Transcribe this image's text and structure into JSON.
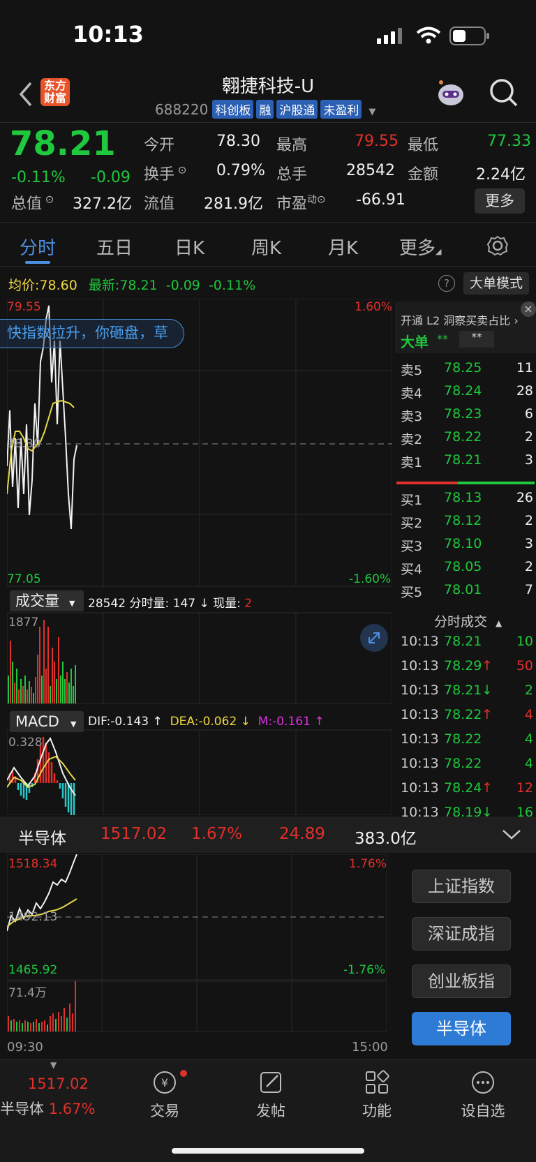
{
  "status": {
    "time": "10:13"
  },
  "header": {
    "title": "翱捷科技-U",
    "code": "688220",
    "tags": [
      "科创板",
      "融",
      "沪股通",
      "未盈利"
    ],
    "logo_line1": "东方",
    "logo_line2": "财富"
  },
  "quote": {
    "price": "78.21",
    "pct": "-0.11%",
    "chg": "-0.09",
    "open_label": "今开",
    "open": "78.30",
    "high_label": "最高",
    "high": "79.55",
    "low_label": "最低",
    "low": "77.33",
    "turnover_label": "换手",
    "turnover": "0.79%",
    "volume_label": "总手",
    "volume": "28542",
    "amount_label": "金额",
    "amount": "2.24亿",
    "mktcap_label": "总值",
    "mktcap": "327.2亿",
    "float_label": "流值",
    "float": "281.9亿",
    "pe_label": "市盈",
    "pe_sup": "动",
    "pe": "-66.91",
    "more": "更多"
  },
  "tabs": [
    "分时",
    "五日",
    "日K",
    "周K",
    "月K",
    "更多"
  ],
  "avg_bar": {
    "avg_label": "均价:",
    "avg": "78.60",
    "latest_label": "最新:",
    "latest": "78.21",
    "chg": "-0.09",
    "pct": "-0.11%",
    "mode_button": "大单模式"
  },
  "chart": {
    "ymax": "79.55",
    "ymin": "77.05",
    "pmax": "1.60%",
    "pmin": "-1.60%",
    "mid": "78.30",
    "banner": "快指数拉升，你砸盘，草"
  },
  "volume_bar": {
    "selector": "成交量",
    "total": "28542",
    "fen_label": "分时量:",
    "fen": "147 ↓",
    "cur_label": "现量:",
    "cur": "2",
    "ymax": "1877"
  },
  "macd_bar": {
    "selector": "MACD",
    "dif": "DIF:-0.143 ↑",
    "dea": "DEA:-0.062 ↓",
    "m": "M:-0.161 ↑",
    "ymax": "0.328"
  },
  "orderbook": {
    "promo": "开通 L2 洞察买卖占比 ›",
    "big_label": "大单",
    "big_val1": "**",
    "big_val2": "**",
    "sells": [
      {
        "l": "卖5",
        "p": "78.25",
        "v": "11"
      },
      {
        "l": "卖4",
        "p": "78.24",
        "v": "28"
      },
      {
        "l": "卖3",
        "p": "78.23",
        "v": "6"
      },
      {
        "l": "卖2",
        "p": "78.22",
        "v": "2"
      },
      {
        "l": "卖1",
        "p": "78.21",
        "v": "3"
      }
    ],
    "buys": [
      {
        "l": "买1",
        "p": "78.13",
        "v": "26"
      },
      {
        "l": "买2",
        "p": "78.12",
        "v": "2"
      },
      {
        "l": "买3",
        "p": "78.10",
        "v": "3"
      },
      {
        "l": "买4",
        "p": "78.05",
        "v": "2"
      },
      {
        "l": "买5",
        "p": "78.01",
        "v": "7"
      }
    ],
    "trades_title": "分时成交",
    "trades": [
      {
        "t": "10:13",
        "p": "78.21",
        "a": "",
        "v": "10"
      },
      {
        "t": "10:13",
        "p": "78.29",
        "a": "↑",
        "v": "50"
      },
      {
        "t": "10:13",
        "p": "78.21",
        "a": "↓",
        "v": "2"
      },
      {
        "t": "10:13",
        "p": "78.22",
        "a": "↑",
        "v": "4"
      },
      {
        "t": "10:13",
        "p": "78.22",
        "a": "",
        "v": "4"
      },
      {
        "t": "10:13",
        "p": "78.22",
        "a": "",
        "v": "4"
      },
      {
        "t": "10:13",
        "p": "78.24",
        "a": "↑",
        "v": "12"
      },
      {
        "t": "10:13",
        "p": "78.19",
        "a": "↓",
        "v": "16"
      }
    ]
  },
  "sector": {
    "name": "半导体",
    "value": "1517.02",
    "pct": "1.67%",
    "chg": "24.89",
    "amount": "383.0亿",
    "ymax": "1518.34",
    "ymin": "1465.92",
    "pmax": "1.76%",
    "pmin": "-1.76%",
    "mid": "1492.13",
    "vol": "71.4万",
    "t_start": "09:30",
    "t_end": "15:00"
  },
  "index_buttons": [
    "上证指数",
    "深证成指",
    "创业板指",
    "半导体"
  ],
  "tabbar": {
    "sector_value": "1517.02",
    "sector_name": "半导体",
    "sector_pct": "1.67%",
    "items": [
      "交易",
      "发帖",
      "功能",
      "设自选"
    ]
  }
}
